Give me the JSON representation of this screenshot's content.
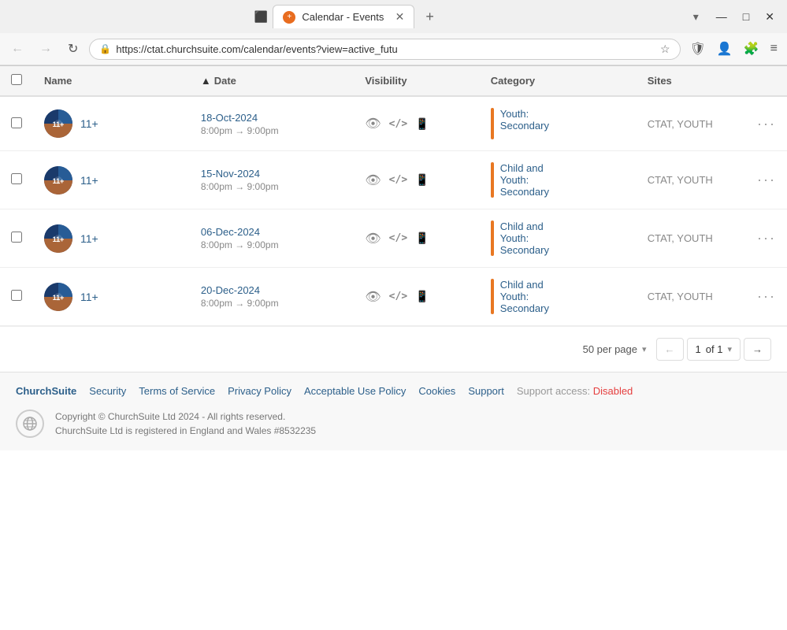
{
  "browser": {
    "tab_title": "Calendar - Events",
    "tab_icon": "+",
    "new_tab_icon": "+",
    "overflow_icon": "▾",
    "nav_back": "←",
    "nav_forward": "→",
    "nav_reload": "↻",
    "address_url_pre": "https://ctat.",
    "address_url_domain": "churchsuite.com",
    "address_url_post": "/calendar/events?view=active_futu",
    "star_icon": "☆",
    "shield_icon": "🛡",
    "user_icon": "👤",
    "puzzle_icon": "🧩",
    "menu_icon": "≡",
    "win_minimize": "—",
    "win_maximize": "□",
    "win_close": "✕",
    "win_tab_box": "⬛"
  },
  "table": {
    "headers": {
      "checkbox": "",
      "name": "Name",
      "date": "Date",
      "visibility": "Visibility",
      "category": "Category",
      "sites": "Sites"
    },
    "rows": [
      {
        "name": "11+",
        "date_main": "18-Oct-2024",
        "date_time": "8:00pm  →  9:00pm",
        "category": "Youth: Secondary",
        "category_lines": [
          "Youth:",
          "Secondary"
        ],
        "sites": "CTAT, YOUTH"
      },
      {
        "name": "11+",
        "date_main": "15-Nov-2024",
        "date_time": "8:00pm  →  9:00pm",
        "category": "Child and Youth: Secondary",
        "category_lines": [
          "Child and",
          "Youth:",
          "Secondary"
        ],
        "sites": "CTAT, YOUTH"
      },
      {
        "name": "11+",
        "date_main": "06-Dec-2024",
        "date_time": "8:00pm  →  9:00pm",
        "category": "Child and Youth: Secondary",
        "category_lines": [
          "Child and",
          "Youth:",
          "Secondary"
        ],
        "sites": "CTAT, YOUTH"
      },
      {
        "name": "11+",
        "date_main": "20-Dec-2024",
        "date_time": "8:00pm  →  9:00pm",
        "category": "Child and Youth: Secondary",
        "category_lines": [
          "Child and",
          "Youth:",
          "Secondary"
        ],
        "sites": "CTAT, YOUTH"
      }
    ]
  },
  "pagination": {
    "per_page_label": "50 per page",
    "dropdown_arrow": "▾",
    "page_current": "1",
    "page_of": "of 1",
    "prev_arrow": "←",
    "next_arrow": "→"
  },
  "footer": {
    "links": [
      {
        "key": "brand",
        "label": "ChurchSuite"
      },
      {
        "key": "security",
        "label": "Security"
      },
      {
        "key": "terms",
        "label": "Terms of Service"
      },
      {
        "key": "privacy",
        "label": "Privacy Policy"
      },
      {
        "key": "acceptable",
        "label": "Acceptable Use Policy"
      },
      {
        "key": "cookies",
        "label": "Cookies"
      },
      {
        "key": "support",
        "label": "Support"
      },
      {
        "key": "support-access",
        "label": "Support access:",
        "status": "Disabled"
      }
    ],
    "copyright_line1": "Copyright © ChurchSuite Ltd 2024 - All rights reserved.",
    "copyright_line2": "ChurchSuite Ltd is registered in England and Wales #8532235"
  }
}
